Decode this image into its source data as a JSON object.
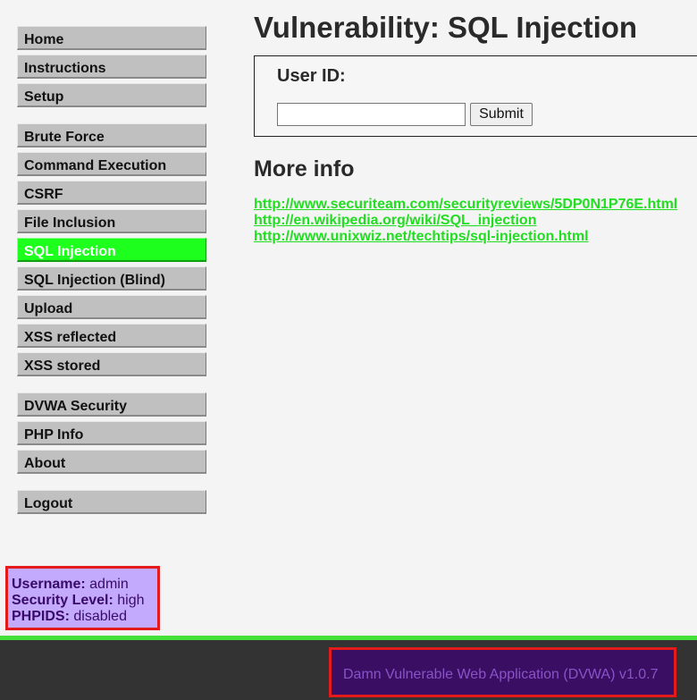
{
  "menu": {
    "group1": [
      {
        "label": "Home"
      },
      {
        "label": "Instructions"
      },
      {
        "label": "Setup"
      }
    ],
    "group2": [
      {
        "label": "Brute Force"
      },
      {
        "label": "Command Execution"
      },
      {
        "label": "CSRF"
      },
      {
        "label": "File Inclusion"
      },
      {
        "label": "SQL Injection",
        "active": true
      },
      {
        "label": "SQL Injection (Blind)"
      },
      {
        "label": "Upload"
      },
      {
        "label": "XSS reflected"
      },
      {
        "label": "XSS stored"
      }
    ],
    "group3": [
      {
        "label": "DVWA Security"
      },
      {
        "label": "PHP Info"
      },
      {
        "label": "About"
      }
    ],
    "group4": [
      {
        "label": "Logout"
      }
    ]
  },
  "main": {
    "title": "Vulnerability: SQL Injection",
    "form": {
      "label": "User ID:",
      "input_value": "",
      "submit_label": "Submit"
    },
    "more_info": {
      "heading": "More info",
      "links": [
        "http://www.securiteam.com/securityreviews/5DP0N1P76E.html",
        "http://en.wikipedia.org/wiki/SQL_injection",
        "http://www.unixwiz.net/techtips/sql-injection.html"
      ]
    }
  },
  "user_info": {
    "username_label": "Username:",
    "username": "admin",
    "security_label": "Security Level:",
    "security": "high",
    "phpids_label": "PHPIDS:",
    "phpids": "disabled"
  },
  "footer": {
    "text": "Damn Vulnerable Web Application (DVWA) v1.0.7"
  },
  "colors": {
    "active_menu": "#1dff1d",
    "menu_bg": "#c0c0c0",
    "link": "#22dd22",
    "highlight_border": "#e41b1b",
    "user_info_bg": "#c3aafc",
    "footer_bg": "#333333",
    "footer_box_bg": "#3a0f63"
  }
}
